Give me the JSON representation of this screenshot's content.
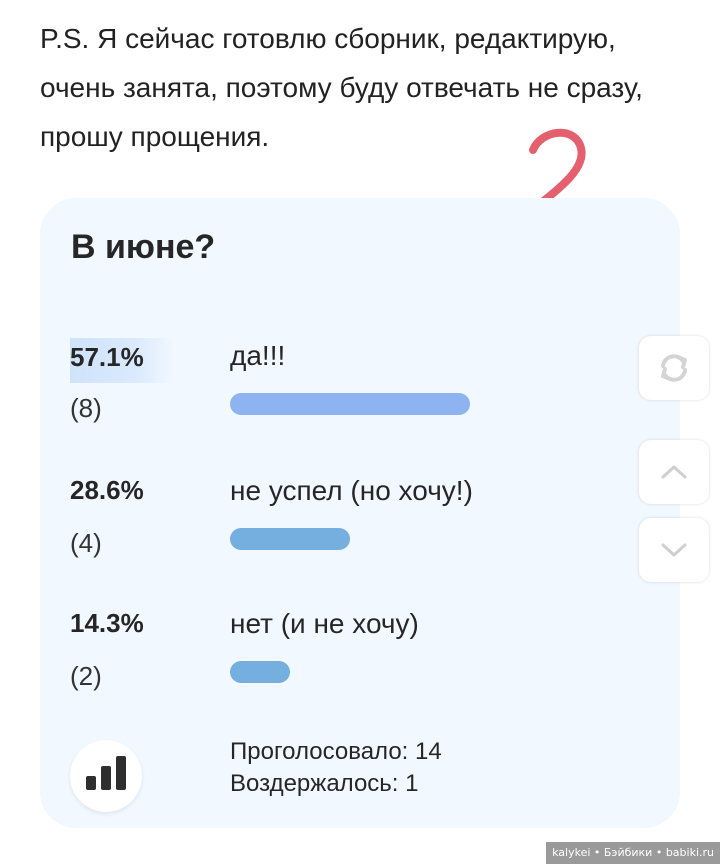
{
  "post": {
    "ps_text": "P.S. Я сейчас готовлю сборник, редактирую, очень занята, поэтому буду отвечать не сразу, прошу прощения."
  },
  "annotation": {
    "text": "2",
    "color": "#e5606e"
  },
  "poll": {
    "title": "В июне?",
    "options": [
      {
        "percent": "57.1%",
        "count": "(8)",
        "label": "да!!!",
        "fraction": 0.571,
        "bar_color": "#8db4f0",
        "selected": true
      },
      {
        "percent": "28.6%",
        "count": "(4)",
        "label": "не успел (но хочу!)",
        "fraction": 0.286,
        "bar_color": "#74afe0"
      },
      {
        "percent": "14.3%",
        "count": "(2)",
        "label": "нет (и не хочу)",
        "fraction": 0.143,
        "bar_color": "#74afe0"
      }
    ],
    "voted": "Проголосовало: 14",
    "abstained": "Воздержалось: 1",
    "stats_icon": "bar-chart-icon"
  },
  "side_controls": {
    "icons": [
      "refresh-icon",
      "chevron-up-icon",
      "chevron-down-icon"
    ]
  },
  "watermark": {
    "text": "kalykei • Бэйбики • babiki.ru"
  }
}
